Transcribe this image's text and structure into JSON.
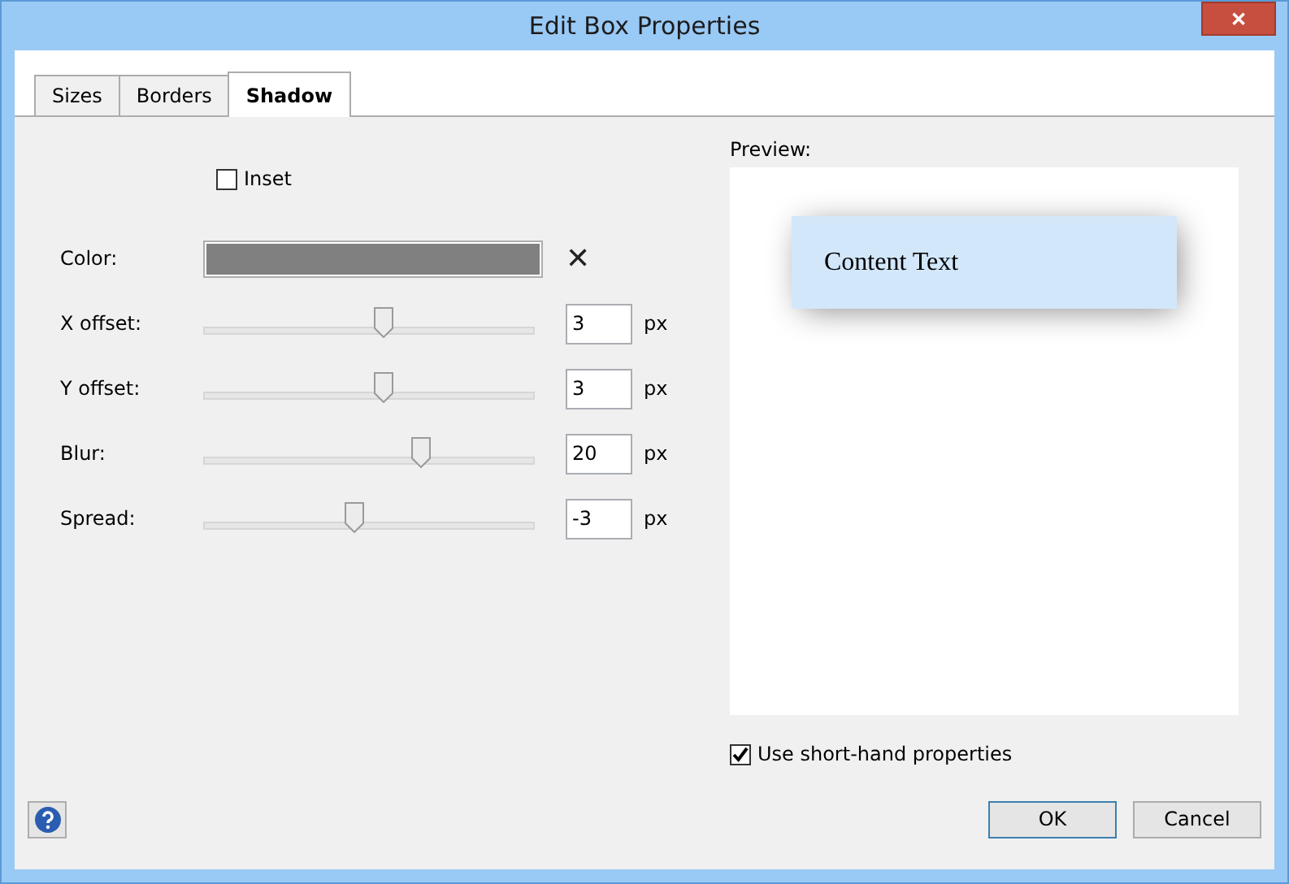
{
  "window": {
    "title": "Edit Box Properties",
    "close": "✕"
  },
  "tabs": [
    {
      "label": "Sizes",
      "selected": false
    },
    {
      "label": "Borders",
      "selected": false
    },
    {
      "label": "Shadow",
      "selected": true
    }
  ],
  "inset": {
    "label": "Inset",
    "checked": false
  },
  "color_field": {
    "label": "Color:",
    "color": "#808080",
    "clear": "✕"
  },
  "sliders": [
    {
      "label": "X offset:",
      "level": 0.545,
      "value": "3",
      "unit": "px"
    },
    {
      "label": "Y offset:",
      "level": 0.545,
      "value": "3",
      "unit": "px"
    },
    {
      "label": "Blur:",
      "level": 0.655,
      "value": "20",
      "unit": "px"
    },
    {
      "label": "Spread:",
      "level": 0.455,
      "value": "-3",
      "unit": "px"
    }
  ],
  "preview": {
    "label": "Preview:",
    "sample_text": "Content Text"
  },
  "shorthand": {
    "label": "Use short-hand properties",
    "checked": true
  },
  "buttons": [
    {
      "label": "OK",
      "default": true
    },
    {
      "label": "Cancel",
      "default": false
    }
  ]
}
